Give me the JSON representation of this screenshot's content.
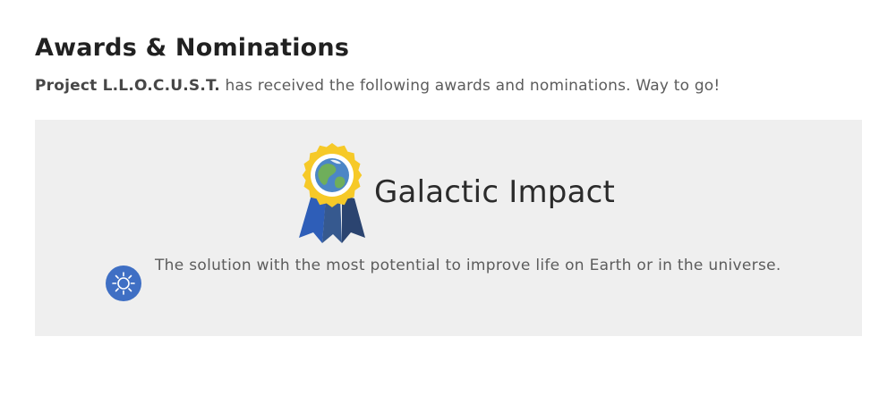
{
  "section": {
    "title": "Awards & Nominations"
  },
  "intro": {
    "project_name": "Project L.L.O.C.U.S.T.",
    "text": " has received the following awards and nominations. Way to go!"
  },
  "award": {
    "title": "Galactic Impact",
    "description": "The solution with the most potential to improve life on Earth or in the universe.",
    "medal_icon": "award-ribbon-medal-earth-icon",
    "category_icon": "sun-icon"
  },
  "colors": {
    "card_background": "#efefef",
    "medal_gold": "#f6c928",
    "ribbon_blue": "#2e5eb8",
    "ribbon_navy": "#2b4470",
    "category_icon_blue": "#3f6fc4"
  }
}
